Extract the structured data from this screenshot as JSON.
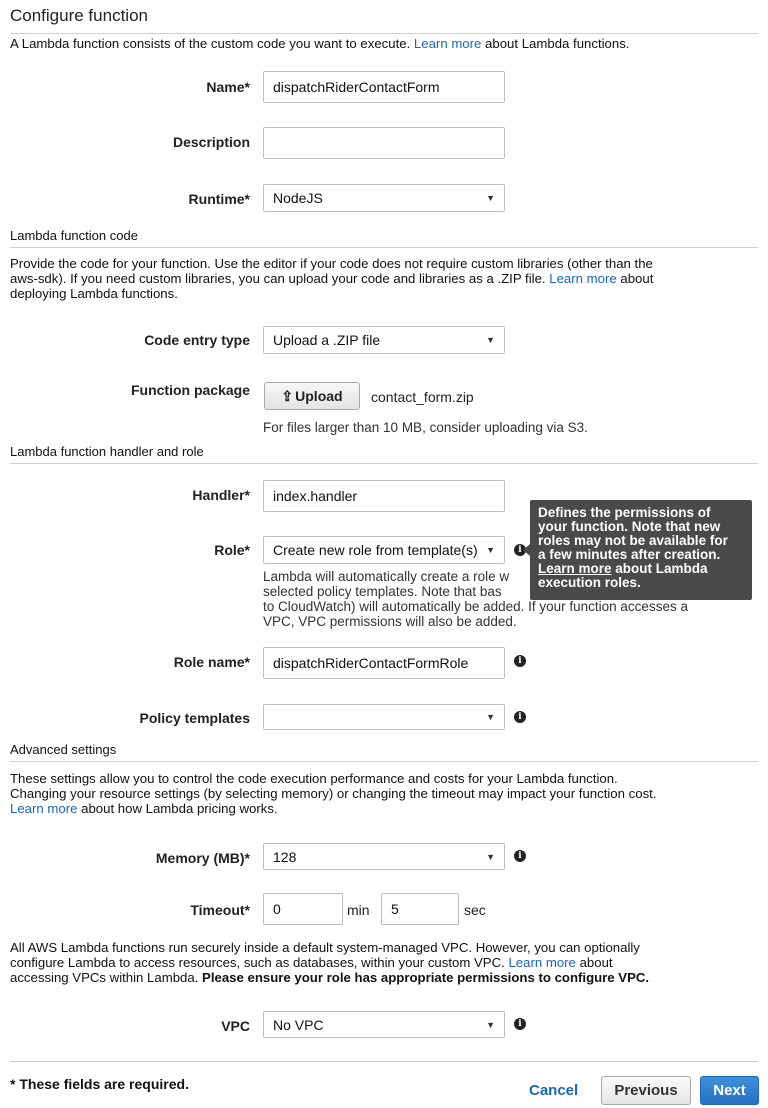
{
  "header": {
    "title": "Configure function",
    "intro_before": "A Lambda function consists of the custom code you want to execute. ",
    "intro_link": "Learn more",
    "intro_after": " about Lambda functions."
  },
  "basic": {
    "name_label": "Name*",
    "name_value": "dispatchRiderContactForm",
    "description_label": "Description",
    "description_value": "",
    "runtime_label": "Runtime*",
    "runtime_value": "NodeJS"
  },
  "code": {
    "section_title": "Lambda function code",
    "desc_line1": "Provide the code for your function. Use the editor if your code does not require custom libraries (other than the",
    "desc_line2_before": "aws-sdk). If you need custom libraries, you can upload your code and libraries as a .ZIP file. ",
    "desc_line2_link": "Learn more",
    "desc_line2_after": " about",
    "desc_line3": "deploying Lambda functions.",
    "entry_type_label": "Code entry type",
    "entry_type_value": "Upload a .ZIP file",
    "package_label": "Function package",
    "upload_button": "Upload",
    "upload_icon": "upload-icon",
    "file_name": "contact_form.zip",
    "size_hint": "For files larger than 10 MB, consider uploading via S3."
  },
  "handler_role": {
    "section_title": "Lambda function handler and role",
    "handler_label": "Handler*",
    "handler_value": "index.handler",
    "role_label": "Role*",
    "role_value": "Create new role from template(s)",
    "role_help_1": "Lambda will automatically create a role w",
    "role_help_2": "selected policy templates. Note that bas",
    "role_help_3": "to CloudWatch) will automatically be added. If your function accesses a",
    "role_help_4": "VPC, VPC permissions will also be added.",
    "tooltip_1": "Defines the permissions of",
    "tooltip_2": "your function. Note that new",
    "tooltip_3": "roles may not be available for",
    "tooltip_4": "a few minutes after creation.",
    "tooltip_link": "Learn more",
    "tooltip_5_after": " about Lambda",
    "tooltip_6": "execution roles.",
    "role_name_label": "Role name*",
    "role_name_value": "dispatchRiderContactFormRole",
    "policy_label": "Policy templates",
    "policy_value": ""
  },
  "advanced": {
    "section_title": "Advanced settings",
    "desc_line1": "These settings allow you to control the code execution performance and costs for your Lambda function.",
    "desc_line2": "Changing your resource settings (by selecting memory) or changing the timeout may impact your function cost.",
    "desc_line3_link": "Learn more",
    "desc_line3_after": " about how Lambda pricing works.",
    "memory_label": "Memory (MB)*",
    "memory_value": "128",
    "timeout_label": "Timeout*",
    "timeout_min": "0",
    "min_unit": "min",
    "timeout_sec": "5",
    "sec_unit": "sec",
    "vpc_line1": "All AWS Lambda functions run securely inside a default system-managed VPC. However, you can optionally",
    "vpc_line2_before": "configure Lambda to access resources, such as databases, within your custom VPC. ",
    "vpc_line2_link": "Learn more",
    "vpc_line2_after": " about",
    "vpc_line3_before": "accessing VPCs within Lambda. ",
    "vpc_line3_bold": "Please ensure your role has appropriate permissions to configure VPC.",
    "vpc_label": "VPC",
    "vpc_value": "No VPC"
  },
  "footer": {
    "required_note": "* These fields are required.",
    "cancel": "Cancel",
    "previous": "Previous",
    "next": "Next"
  },
  "colors": {
    "link": "#1a66b8",
    "primary_button": "#2f7fd0",
    "tooltip_bg": "#4a4a4a"
  }
}
